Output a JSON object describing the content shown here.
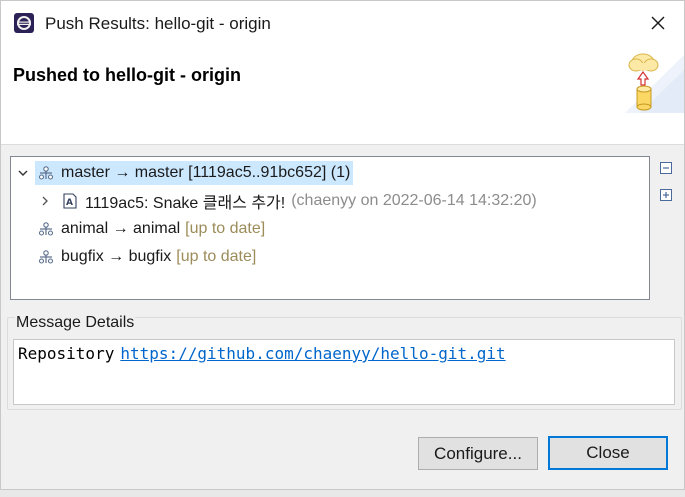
{
  "window": {
    "title": "Push Results: hello-git - origin",
    "close_icon": "close-icon"
  },
  "banner": {
    "title": "Pushed to hello-git - origin"
  },
  "tree": {
    "rows": [
      {
        "label": "master → master [1119ac5..91bc652] (1)",
        "expanded": true,
        "selected": true,
        "icon": "branch-ref-icon"
      },
      {
        "label": "1119ac5: Snake 클래스 추가!",
        "meta": "(chaenyy on 2022-06-14 14:32:20)",
        "expanded": false,
        "icon": "commit-icon"
      },
      {
        "label": "animal → animal",
        "status": "[up to date]",
        "icon": "branch-ref-icon"
      },
      {
        "label": "bugfix → bugfix",
        "status": "[up to date]",
        "icon": "branch-ref-icon"
      }
    ],
    "collapse_all_icon": "collapse-all-icon",
    "expand_all_icon": "expand-all-icon"
  },
  "message": {
    "group_label": "Message Details",
    "prefix": "Repository",
    "link": "https://github.com/chaenyy/hello-git.git"
  },
  "buttons": {
    "configure": "Configure...",
    "close": "Close"
  },
  "colors": {
    "selection": "#cce8ff",
    "link": "#0066cc",
    "default_button_border": "#0078d7",
    "status_text": "#9c8c5a"
  }
}
